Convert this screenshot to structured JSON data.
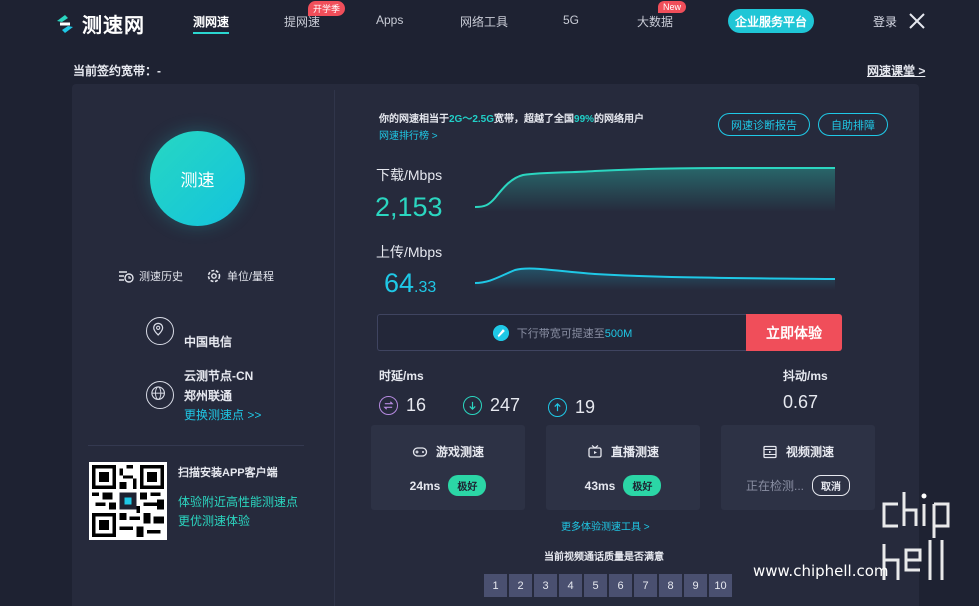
{
  "brand": {
    "name": "测速网"
  },
  "nav": {
    "items": [
      {
        "label": "测网速",
        "active": true
      },
      {
        "label": "提网速",
        "badge": "开学季"
      },
      {
        "label": "Apps"
      },
      {
        "label": "网络工具"
      },
      {
        "label": "5G"
      },
      {
        "label": "大数据",
        "badge": "New"
      }
    ],
    "enterprise": "企业服务平台",
    "login": "登录"
  },
  "subheader": {
    "bandwidth": "当前签约宽带：-",
    "classroom": "网速课堂 >"
  },
  "left": {
    "speed_button": "测速",
    "history": "测速历史",
    "units": "单位/量程",
    "isp": "中国电信",
    "node_name": "云测节点-CN",
    "node_isp": "郑州联通",
    "change_node": "更换测速点 >>",
    "qr_title": "扫描安装APP客户端",
    "qr_line1": "体验附近高性能测速点",
    "qr_line2": "更优测速体验"
  },
  "summary": {
    "prefix": "你的网速相当于",
    "range": "2G～2.5G",
    "mid": "宽带，超越了全国",
    "percent": "99%",
    "suffix": "的网络用户",
    "rank_link": "网速排行榜 >",
    "diag_button": "网速诊断报告",
    "self_button": "自助排障"
  },
  "download": {
    "label": "下载/Mbps",
    "value": "2,153"
  },
  "upload": {
    "label": "上传/Mbps",
    "value_int": "64",
    "value_dec": ".33"
  },
  "promo": {
    "text": "下行带宽可提速至",
    "highlight": "500M",
    "button": "立即体验"
  },
  "latency": {
    "label": "时延/ms",
    "ping": "16",
    "down": "247",
    "up": "19",
    "jitter_label": "抖动/ms",
    "jitter": "0.67"
  },
  "cards": [
    {
      "title": "游戏测速",
      "value": "24ms",
      "rating": "极好"
    },
    {
      "title": "直播测速",
      "value": "43ms",
      "rating": "极好"
    },
    {
      "title": "视频测速",
      "status": "正在检测...",
      "cancel": "取消"
    }
  ],
  "more_tools": "更多体验测速工具 >",
  "satisfaction": {
    "question": "当前视频通话质量是否满意",
    "scores": [
      "1",
      "2",
      "3",
      "4",
      "5",
      "6",
      "7",
      "8",
      "9",
      "10"
    ]
  },
  "watermark": "www.chiphell.com",
  "colors": {
    "accent": "#2bd6c0",
    "link": "#1fc8e6",
    "danger": "#f04e5a",
    "bg": "#1e2232"
  }
}
